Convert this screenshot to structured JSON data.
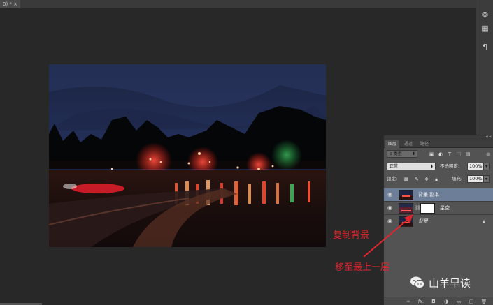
{
  "document": {
    "tab_label": "0) * ×"
  },
  "dock": {
    "icons": [
      "swatches-3d-icon",
      "grid-icon",
      "paragraph-icon"
    ]
  },
  "layers_panel": {
    "tabs": [
      {
        "label": "图层",
        "active": true
      },
      {
        "label": "通道",
        "active": false
      },
      {
        "label": "路径",
        "active": false
      }
    ],
    "filter": {
      "label": "ρ 类型"
    },
    "blend_mode": "正常",
    "opacity_label": "不透明度:",
    "opacity_value": "100%",
    "lock_label": "锁定:",
    "fill_label": "填充:",
    "fill_value": "100%",
    "layers": [
      {
        "name": "背景 副本",
        "selected": true,
        "has_mask": false,
        "italic": false,
        "locked": false
      },
      {
        "name": "星空",
        "selected": false,
        "has_mask": true,
        "italic": false,
        "locked": false
      },
      {
        "name": "背景",
        "selected": false,
        "has_mask": false,
        "italic": true,
        "locked": true
      }
    ],
    "bottom_icons": [
      "link-icon",
      "fx-icon",
      "mask-icon",
      "adjustment-icon",
      "folder-icon",
      "new-layer-icon",
      "trash-icon"
    ],
    "fx_label": "fx."
  },
  "annotations": {
    "copy_bg": "复制背景",
    "move_top": "移至最上一层"
  },
  "watermark": {
    "text": "山羊早读"
  },
  "colors": {
    "accent_red": "#e0262c",
    "selected_layer": "#6d7e99"
  }
}
